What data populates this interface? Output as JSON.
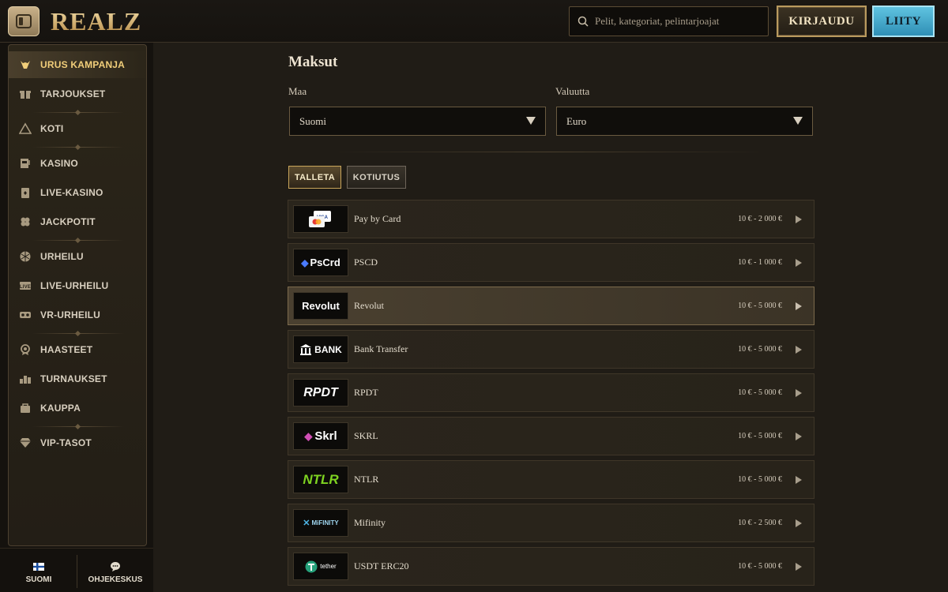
{
  "header": {
    "logo": "REALZ",
    "search_placeholder": "Pelit, kategoriat, pelintarjoajat",
    "login_label": "KIRJAUDU",
    "join_label": "LIITY"
  },
  "sidebar": {
    "items": [
      {
        "label": "URUS KAMPANJA",
        "icon": "bull-icon",
        "active": true
      },
      {
        "label": "TARJOUKSET",
        "icon": "gift-icon"
      },
      {
        "label": "KOTI",
        "icon": "home-icon"
      },
      {
        "label": "KASINO",
        "icon": "slot-machine-icon"
      },
      {
        "label": "LIVE-KASINO",
        "icon": "cards-icon"
      },
      {
        "label": "JACKPOTIT",
        "icon": "clover-icon"
      },
      {
        "label": "URHEILU",
        "icon": "ball-icon"
      },
      {
        "label": "LIVE-URHEILU",
        "icon": "live-icon"
      },
      {
        "label": "VR-URHEILU",
        "icon": "vr-icon"
      },
      {
        "label": "HAASTEET",
        "icon": "medal-icon"
      },
      {
        "label": "TURNAUKSET",
        "icon": "tournament-icon"
      },
      {
        "label": "KAUPPA",
        "icon": "bag-icon"
      },
      {
        "label": "VIP-TASOT",
        "icon": "diamond-icon"
      }
    ],
    "bottom": {
      "language_label": "SUOMI",
      "help_label": "OHJEKESKUS"
    }
  },
  "main": {
    "title": "Maksut",
    "country_label": "Maa",
    "country_value": "Suomi",
    "currency_label": "Valuutta",
    "currency_value": "Euro",
    "tabs": [
      {
        "label": "TALLETA",
        "active": true
      },
      {
        "label": "KOTIUTUS",
        "active": false
      }
    ],
    "methods": [
      {
        "logo": "VISA",
        "name": "Pay by Card",
        "limits": "10 € - 2 000 €"
      },
      {
        "logo": "PsCrd",
        "name": "PSCD",
        "limits": "10 € - 1 000 €"
      },
      {
        "logo": "Revolut",
        "name": "Revolut",
        "limits": "10 € - 5 000 €",
        "highlight": true
      },
      {
        "logo": "BANK",
        "name": "Bank Transfer",
        "limits": "10 € - 5 000 €"
      },
      {
        "logo": "RPDT",
        "name": "RPDT",
        "limits": "10 € - 5 000 €"
      },
      {
        "logo": "Skrl",
        "name": "SKRL",
        "limits": "10 € - 5 000 €"
      },
      {
        "logo": "NTLR",
        "name": "NTLR",
        "limits": "10 € - 5 000 €"
      },
      {
        "logo": "MiFINITY",
        "name": "Mifinity",
        "limits": "10 € - 2 500 €"
      },
      {
        "logo": "tether",
        "name": "USDT ERC20",
        "limits": "10 € - 5 000 €"
      }
    ]
  },
  "colors": {
    "accent_gold": "#f1ce7a",
    "join_blue": "#2f8fb5",
    "background": "#201c16"
  }
}
